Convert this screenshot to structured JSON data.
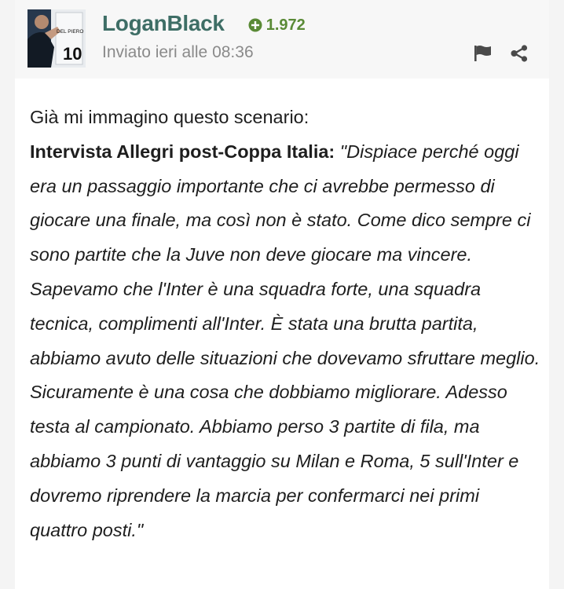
{
  "post": {
    "author": "LoganBlack",
    "reputation": "1.972",
    "timestamp": "Inviato ieri alle 08:36",
    "avatar_text": "DEL PIERO 10",
    "body": {
      "intro": "Già mi immagino questo scenario:",
      "speaker": "Intervista Allegri post-Coppa Italia:",
      "quote": "\"Dispiace perché oggi era un passaggio importante che ci avrebbe permesso di giocare una finale, ma così non è stato. Come dico sempre ci sono partite che la Juve non deve giocare ma vincere. Sapevamo che l'Inter è una squadra forte, una squadra tecnica, complimenti all'Inter. È stata una brutta partita, abbiamo avuto delle situazioni che dovevamo sfruttare meglio. Sicuramente è una cosa che dobbiamo migliorare. Adesso testa al campionato. Abbiamo perso 3 partite di fila, ma abbiamo 3 punti di vantaggio su Milan e Roma, 5 sull'Inter e dovremo riprendere la marcia per confermarci nei primi quattro posti.\""
    }
  },
  "icons": {
    "reputation": "plus-circle-icon",
    "report": "flag-icon",
    "share": "share-icon"
  },
  "colors": {
    "author": "#3e6e66",
    "reputation": "#5a8a36",
    "header_bg": "#f7f7f7",
    "icons": "#4a4a4a"
  }
}
